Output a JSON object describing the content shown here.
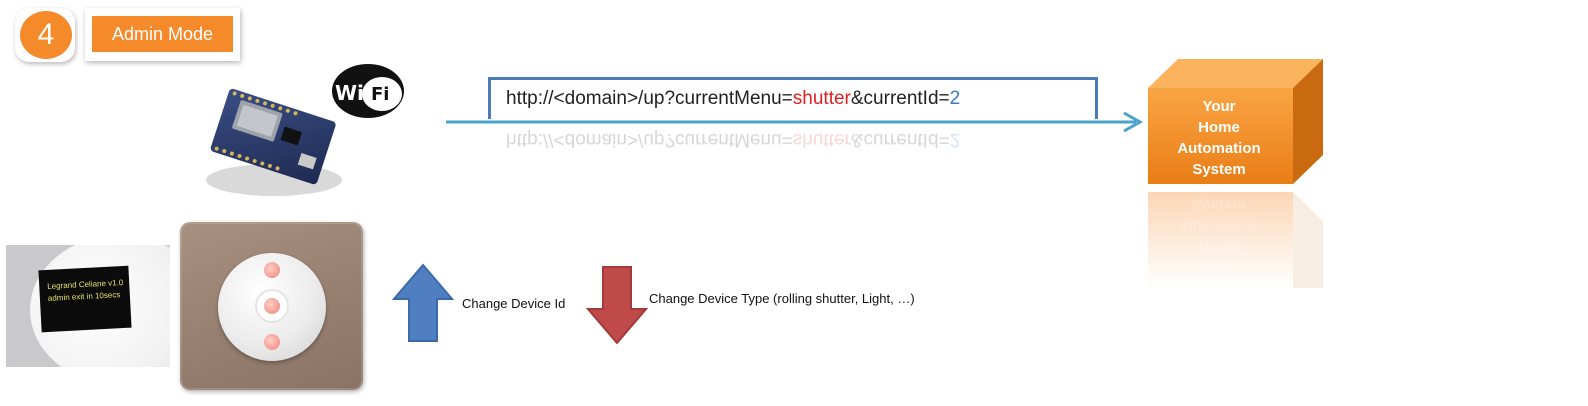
{
  "step": {
    "number": "4",
    "mode_label": "Admin Mode"
  },
  "wifi_logo": {
    "left": "Wi",
    "right": "Fi"
  },
  "url": {
    "prefix": "http://<domain>/up?currentMenu=",
    "menu_value": "shutter",
    "mid": "&currentId=",
    "id_value": "2"
  },
  "target": {
    "lines": [
      "Your",
      "Home",
      "Automation",
      "System"
    ]
  },
  "lcd": {
    "line1": "Legrand Celiane v1.0",
    "line2": "admin exit in 10secs"
  },
  "actions": {
    "up_label": "Change Device Id",
    "down_label": "Change Device Type (rolling shutter, Light, …)"
  },
  "colors": {
    "orange": "#f58a2b",
    "arrow_line": "#4aa3c8",
    "url_border": "#4a7bb5",
    "up_arrow": "#4f7fc0",
    "down_arrow": "#c04a4a"
  }
}
